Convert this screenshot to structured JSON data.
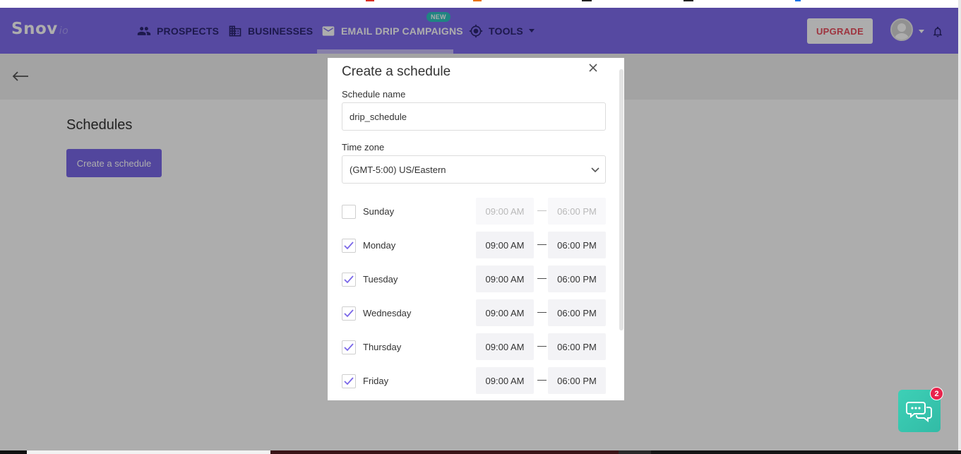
{
  "app": {
    "logo_main": "Snov",
    "logo_sub": "io"
  },
  "nav": {
    "items": [
      {
        "label": "PROSPECTS",
        "icon": "people-icon",
        "active": false
      },
      {
        "label": "BUSINESSES",
        "icon": "building-icon",
        "active": false
      },
      {
        "label": "EMAIL DRIP CAMPAIGNS",
        "icon": "envelope-icon",
        "active": true,
        "badge": "NEW"
      },
      {
        "label": "TOOLS",
        "icon": "crosshair-icon",
        "active": false,
        "has_dropdown": true
      }
    ],
    "upgrade_label": "UPGRADE"
  },
  "page": {
    "title": "Schedules",
    "create_button": "Create a schedule"
  },
  "modal": {
    "title": "Create a schedule",
    "schedule_name_label": "Schedule name",
    "schedule_name_value": "drip_schedule",
    "timezone_label": "Time zone",
    "timezone_value": "(GMT-5:00) US/Eastern",
    "days": [
      {
        "name": "Sunday",
        "checked": false,
        "start": "09:00 AM",
        "end": "06:00 PM"
      },
      {
        "name": "Monday",
        "checked": true,
        "start": "09:00 AM",
        "end": "06:00 PM"
      },
      {
        "name": "Tuesday",
        "checked": true,
        "start": "09:00 AM",
        "end": "06:00 PM"
      },
      {
        "name": "Wednesday",
        "checked": true,
        "start": "09:00 AM",
        "end": "06:00 PM"
      },
      {
        "name": "Thursday",
        "checked": true,
        "start": "09:00 AM",
        "end": "06:00 PM"
      },
      {
        "name": "Friday",
        "checked": true,
        "start": "09:00 AM",
        "end": "06:00 PM"
      }
    ],
    "dash": "—"
  },
  "chat": {
    "unread_count": "2"
  },
  "colors": {
    "nav_bg": "#7f6cee",
    "accent": "#7a67e8",
    "upgrade_text": "#e94d5d",
    "chat_bg": "#3dd0b6",
    "badge_red": "#e8244c",
    "new_badge": "#2ec4c0"
  }
}
